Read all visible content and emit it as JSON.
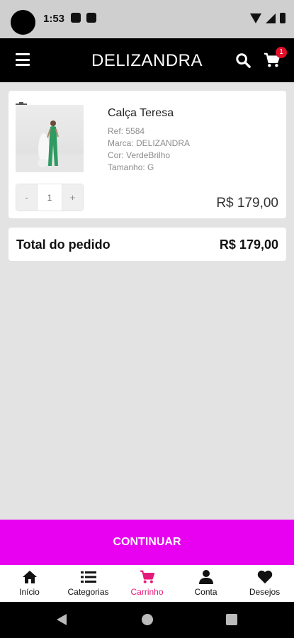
{
  "status_bar": {
    "time": "1:53"
  },
  "header": {
    "brand": "DELIZANDRA",
    "cart_count": "1"
  },
  "cart_item": {
    "name": "Calça Teresa",
    "ref": "Ref: 5584",
    "brand": "Marca: DELIZANDRA",
    "color": "Cor: VerdeBrilho",
    "size": "Tamanho: G",
    "qty_minus": "-",
    "quantity": "1",
    "qty_plus": "+",
    "price": "R$ 179,00"
  },
  "summary": {
    "total_label": "Total do pedido",
    "total_value": "R$ 179,00"
  },
  "continue_label": "CONTINUAR",
  "colors": {
    "accent": "#e800f0",
    "active_nav": "#e6197a",
    "app_bar": "#000000",
    "badge": "#e0102a"
  },
  "bottom_nav": [
    {
      "label": "Início",
      "icon": "home-icon",
      "active": false
    },
    {
      "label": "Categorias",
      "icon": "list-icon",
      "active": false
    },
    {
      "label": "Carrinho",
      "icon": "cart-icon",
      "active": true
    },
    {
      "label": "Conta",
      "icon": "person-icon",
      "active": false
    },
    {
      "label": "Desejos",
      "icon": "heart-icon",
      "active": false
    }
  ]
}
